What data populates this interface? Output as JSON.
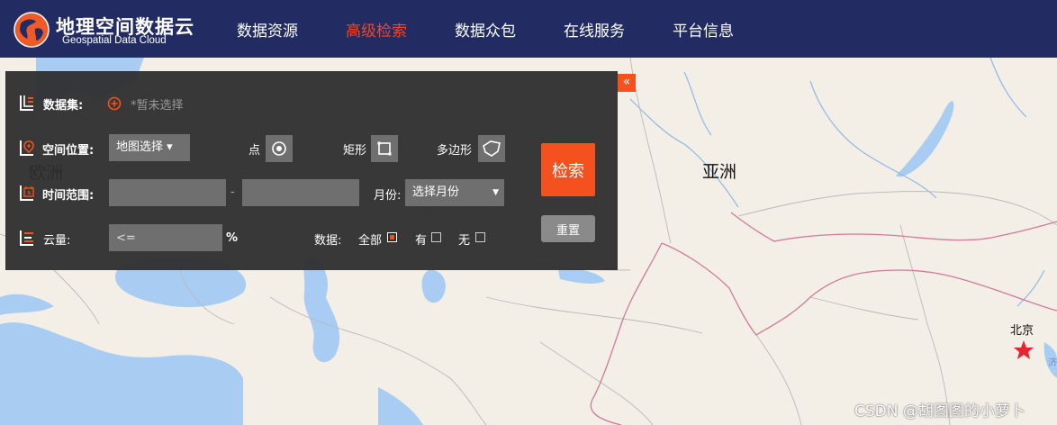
{
  "brand": {
    "title": "地理空间数据云",
    "subtitle": "Geospatial Data Cloud"
  },
  "nav": [
    {
      "label": "数据资源"
    },
    {
      "label": "高级检索",
      "active": true
    },
    {
      "label": "数据众包"
    },
    {
      "label": "在线服务"
    },
    {
      "label": "平台信息"
    }
  ],
  "panel": {
    "collapse_glyph": "«",
    "dataset": {
      "label": "数据集:",
      "hint": "*暂未选择"
    },
    "location": {
      "label": "空间位置:",
      "select_value": "地图选择 ▾",
      "point": "点",
      "rect": "矩形",
      "polygon": "多边形"
    },
    "time": {
      "label": "时间范围:",
      "separator": "-",
      "month_label": "月份:",
      "month_value": "选择月份"
    },
    "cloud": {
      "label": "云量:",
      "placeholder": "<=",
      "unit": "%"
    },
    "data_filter": {
      "label": "数据:",
      "all": "全部",
      "yes": "有",
      "no": "无"
    },
    "search_label": "检索",
    "reset_label": "重置"
  },
  "map": {
    "labels": {
      "europe": "欧洲",
      "asia": "亚洲",
      "beijing": "北京",
      "partial": "济"
    }
  },
  "watermark": "CSDN @胡图图的小萝卜",
  "colors": {
    "header": "#232c62",
    "accent": "#f4511e",
    "active_nav": "#f0452a",
    "land": "#f3efe6",
    "water": "#a9ccf2"
  }
}
